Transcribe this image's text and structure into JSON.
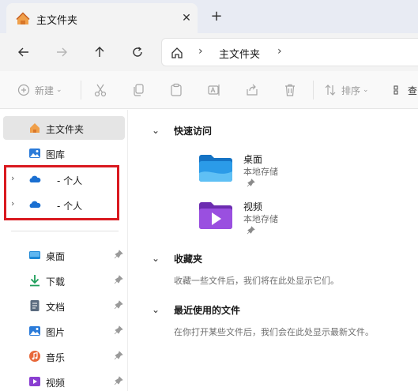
{
  "tab": {
    "title": "主文件夹",
    "close": "✕",
    "new_tab": "+"
  },
  "address": {
    "path": "主文件夹",
    "separator": "›"
  },
  "toolbar": {
    "new_label": "新建",
    "sort_label": "排序",
    "view_label": "查"
  },
  "sidebar": {
    "items": [
      {
        "label": "主文件夹",
        "icon": "home-icon"
      },
      {
        "label": "图库",
        "icon": "gallery-icon"
      },
      {
        "label": "- 个人",
        "icon": "onedrive-cloud-icon"
      },
      {
        "label": "- 个人",
        "icon": "onedrive-cloud-icon"
      }
    ],
    "pinned": [
      {
        "label": "桌面",
        "icon": "desktop-icon"
      },
      {
        "label": "下载",
        "icon": "download-icon"
      },
      {
        "label": "文档",
        "icon": "document-icon"
      },
      {
        "label": "图片",
        "icon": "pictures-icon"
      },
      {
        "label": "音乐",
        "icon": "music-icon"
      },
      {
        "label": "视频",
        "icon": "video-icon"
      }
    ]
  },
  "main": {
    "quick_access": {
      "title": "快速访问",
      "items": [
        {
          "name": "桌面",
          "location": "本地存储"
        },
        {
          "name": "视频",
          "location": "本地存储"
        }
      ]
    },
    "favorites": {
      "title": "收藏夹",
      "empty_text": "收藏一些文件后，我们将在此处显示它们。"
    },
    "recent": {
      "title": "最近使用的文件",
      "empty_text": "在你打开某些文件后，我们会在此处显示最新文件。"
    }
  },
  "colors": {
    "accent": "#1a6fd1",
    "highlight": "#d9191f",
    "folder_blue": "#1e88d6",
    "folder_purple": "#8a3fd1"
  }
}
